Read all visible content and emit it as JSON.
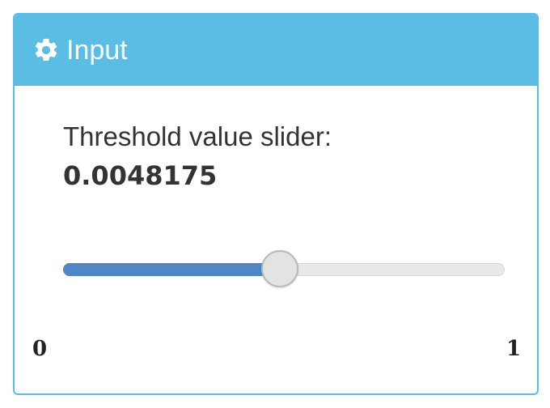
{
  "panel": {
    "header_icon": "gear-icon",
    "title": "Input",
    "header_color": "#5bbde4"
  },
  "slider": {
    "label": "Threshold value slider:",
    "value_text": "0.0048175",
    "min_label": "0",
    "max_label": "1",
    "fill_fraction": 0.49,
    "fill_color": "#4f86c6"
  }
}
